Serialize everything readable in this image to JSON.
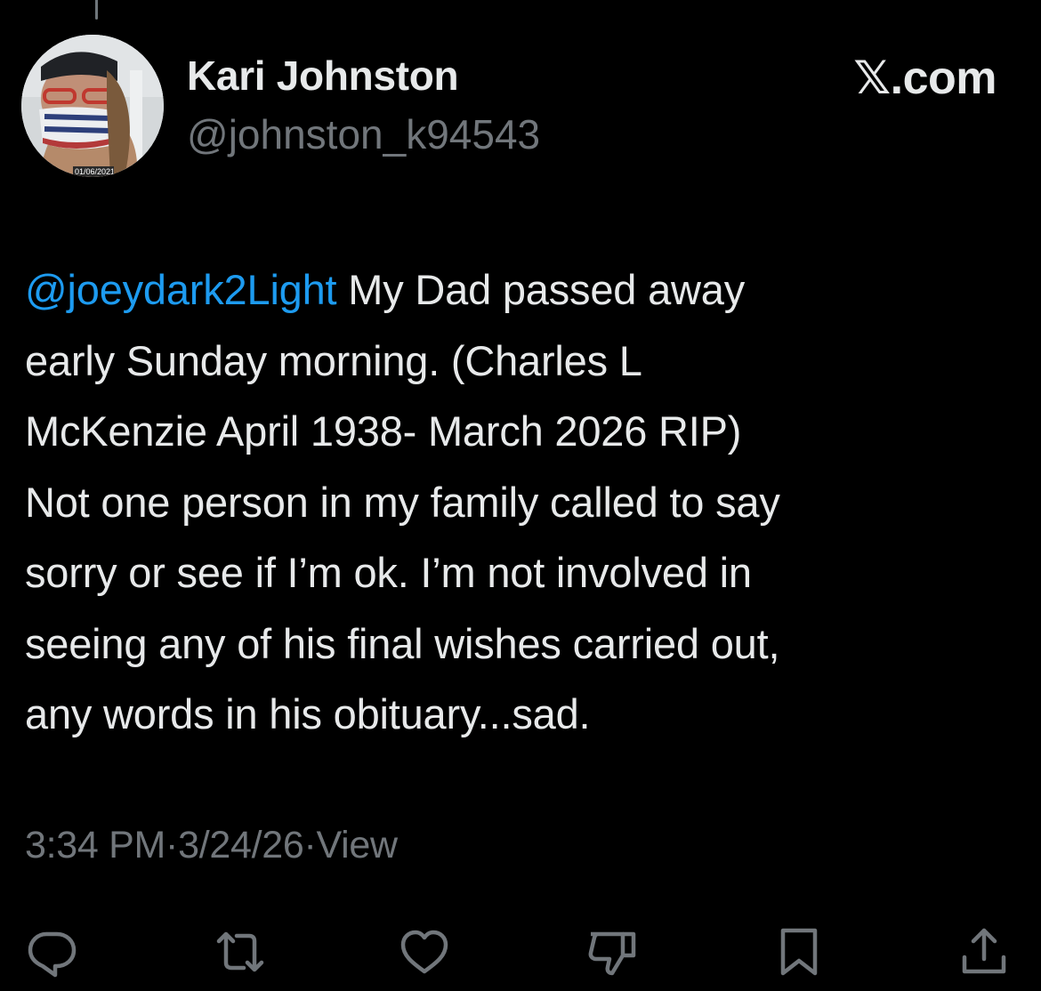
{
  "header": {
    "display_name": "Kari Johnston",
    "handle": "@johnston_k94543",
    "brand": "𝕏.com",
    "avatar": {
      "date_overlay": "01/06/2021"
    }
  },
  "tweet": {
    "mention": "@joeydark2Light",
    "lines": [
      " My Dad passed away",
      "early Sunday morning. (Charles L",
      "McKenzie April 1938- March 2026 RIP)",
      "Not one person in my family called to say",
      "sorry or see if I’m ok. I’m not involved in",
      "seeing any of his final wishes carried out,",
      "any words in his obituary...sad."
    ]
  },
  "meta": {
    "time": "3:34 PM",
    "separator": " · ",
    "date": "3/24/26",
    "views_label": "View"
  },
  "actions": {
    "icons": [
      "reply-icon",
      "retweet-icon",
      "like-icon",
      "dislike-icon",
      "bookmark-icon",
      "share-icon"
    ]
  },
  "colors": {
    "background": "#000000",
    "text": "#e7e9ea",
    "secondary": "#71767b",
    "accent": "#1d9bf0"
  }
}
